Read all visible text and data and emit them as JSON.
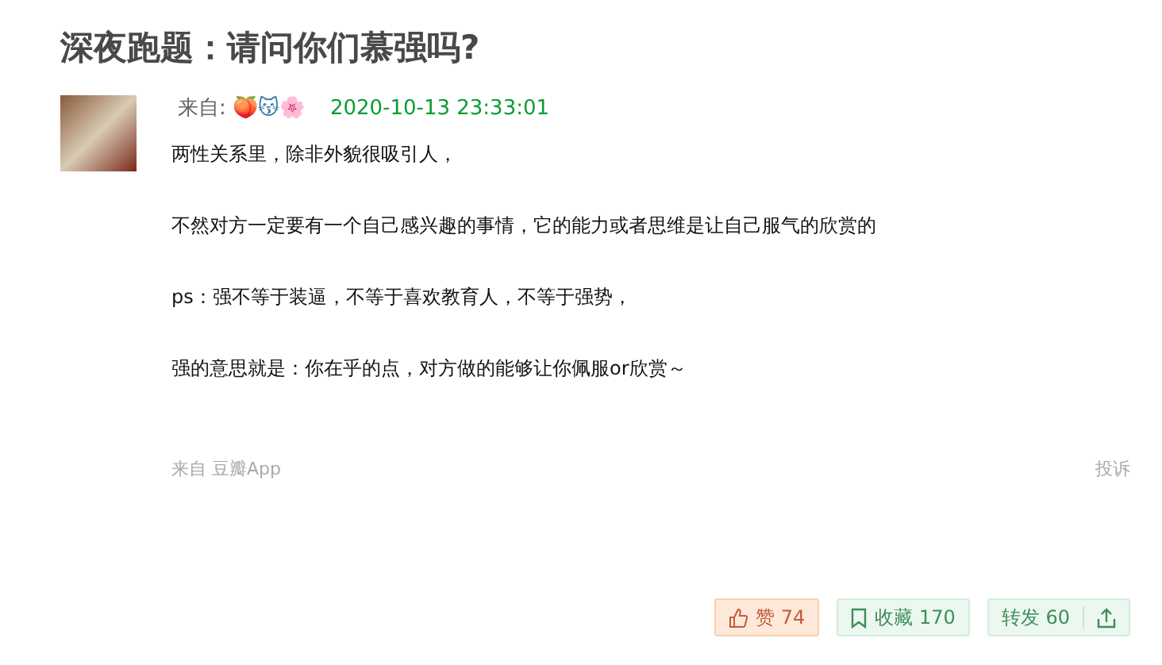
{
  "title": "深夜跑题：请问你们慕强吗?",
  "post": {
    "from_label": "来自:",
    "author": "🍑😽🌸",
    "time": "2020-10-13 23:33:01",
    "paragraphs": [
      "两性关系里，除非外貌很吸引人，",
      "不然对方一定要有一个自己感兴趣的事情，它的能力或者思维是让自己服气的欣赏的",
      "ps：强不等于装逼，不等于喜欢教育人，不等于强势，",
      "强的意思就是：你在乎的点，对方做的能够让你佩服or欣赏～"
    ],
    "source": "来自 豆瓣App",
    "report": "投诉"
  },
  "actions": {
    "like": {
      "label": "赞 74",
      "selected": true
    },
    "collect": {
      "label": "收藏 170",
      "selected": false
    },
    "reshare": {
      "label": "转发 60"
    }
  }
}
